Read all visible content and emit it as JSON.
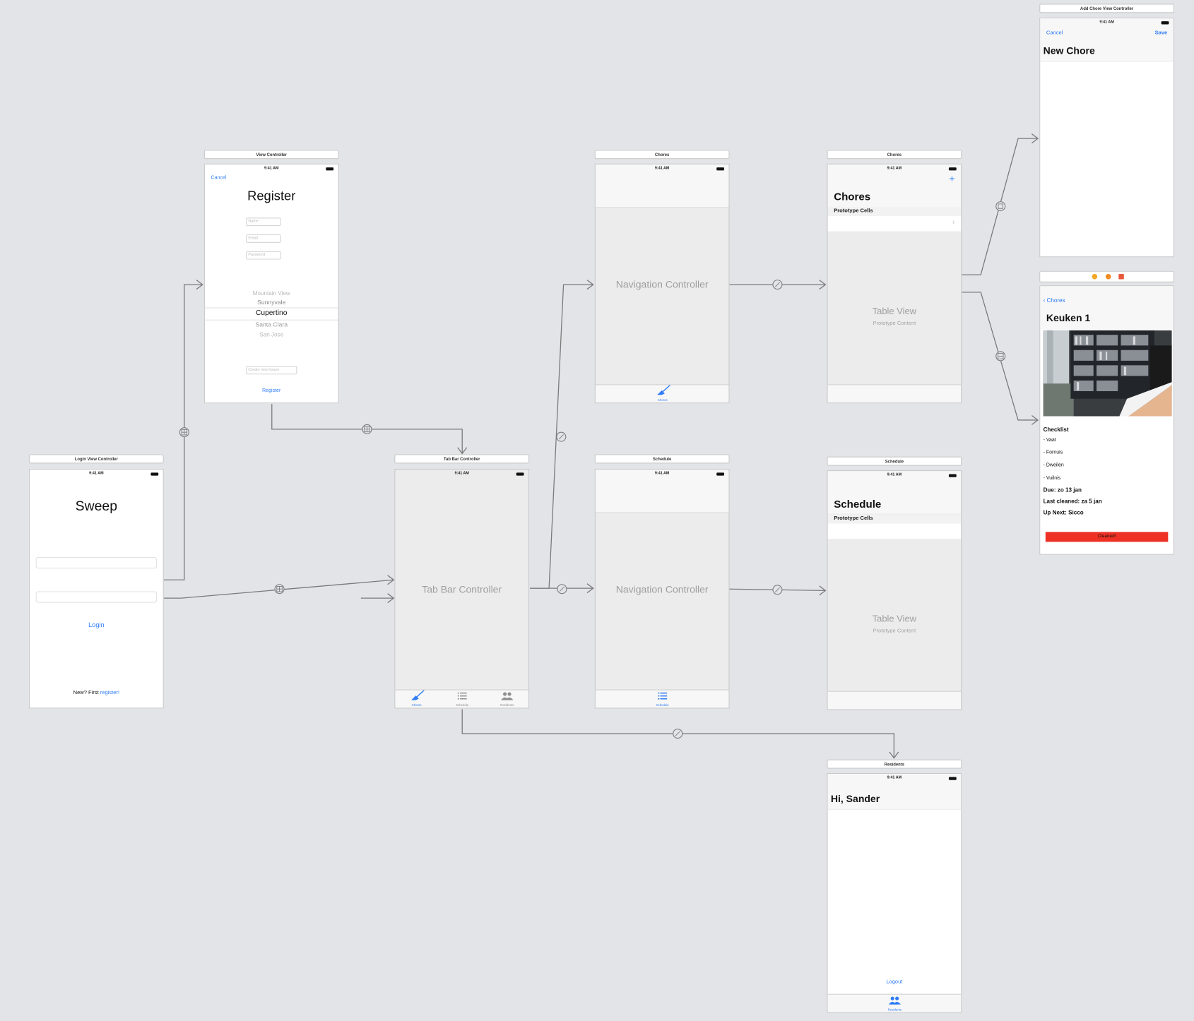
{
  "scenes": {
    "login": {
      "title": "Login View Controller",
      "status_time": "9:41 AM",
      "app_name": "Sweep",
      "login_label": "Login",
      "footer_prefix": "New? First",
      "footer_link": "register!"
    },
    "register": {
      "title": "View Controller",
      "status_time": "9:41 AM",
      "cancel_label": "Cancel",
      "heading": "Register",
      "name_placeholder": "Name",
      "email_placeholder": "Email",
      "password_placeholder": "Password",
      "picker_options": [
        "Mountain View",
        "Sunnyvale",
        "Cupertino",
        "Santa Clara",
        "San Jose"
      ],
      "picker_selected": "Cupertino",
      "house_placeholder": "Create new house",
      "register_label": "Register"
    },
    "tabbar": {
      "title": "Tab Bar Controller",
      "status_time": "9:41 AM",
      "label": "Tab Bar Controller",
      "tabs": [
        "Chores",
        "Schedule",
        "Residents"
      ]
    },
    "nav_chores": {
      "title": "Chores",
      "status_time": "9:41 AM",
      "label": "Navigation Controller",
      "tab_label": "Chores"
    },
    "nav_schedule": {
      "title": "Schedule",
      "status_time": "9:41 AM",
      "label": "Navigation Controller",
      "tab_label": "Schedule"
    },
    "chores_table": {
      "title": "Chores",
      "status_time": "9:41 AM",
      "add_symbol": "+",
      "heading": "Chores",
      "section": "Prototype Cells",
      "chevron": "›",
      "table_label": "Table View",
      "table_sub": "Prototype Content"
    },
    "schedule_table": {
      "title": "Schedule",
      "status_time": "9:41 AM",
      "heading": "Schedule",
      "section": "Prototype Cells",
      "table_label": "Table View",
      "table_sub": "Prototype Content"
    },
    "residents": {
      "title": "Residents",
      "status_time": "9:41 AM",
      "heading": "Hi, Sander",
      "logout_label": "Logout",
      "tab_label": "Residents"
    },
    "add_chore": {
      "title": "Add Chore View Controller",
      "status_time": "9:41 AM",
      "cancel_label": "Cancel",
      "save_label": "Save",
      "heading": "New Chore"
    },
    "detail": {
      "back_label": "Chores",
      "heading": "Keuken 1",
      "checklist_title": "Checklist",
      "checklist_items": [
        "- Vaat",
        "- Fornuis",
        "- Dweilen",
        "- Vuilnis"
      ],
      "due": "Due: zo 13 jan",
      "last_cleaned": "Last cleaned: za 5 jan",
      "up_next": "Up Next: Sicco",
      "button_label": "Cleaned!",
      "button_color": "#ee3124"
    }
  },
  "colors": {
    "canvas_bg": "#e3e4e8",
    "accent": "#2f7cf6",
    "connector": "#7a7a7a"
  }
}
